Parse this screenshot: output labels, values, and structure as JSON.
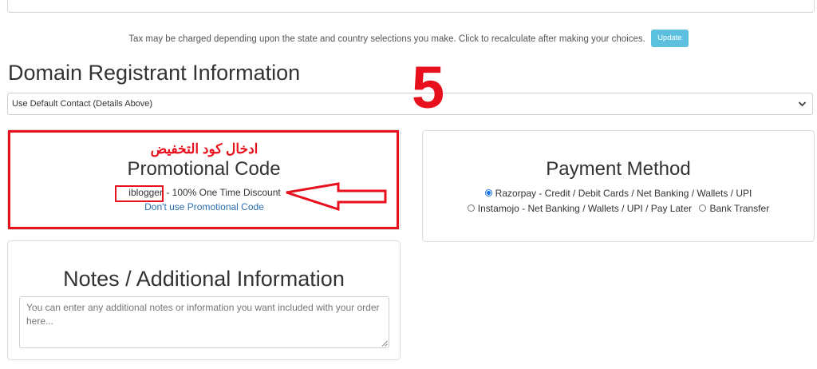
{
  "tax": {
    "text": "Tax may be charged depending upon the state and country selections you make. Click to recalculate after making your choices.",
    "update_label": "Update"
  },
  "registrant": {
    "title": "Domain Registrant Information",
    "select_value": "Use Default Contact (Details Above)"
  },
  "annotation": {
    "step_number": "5",
    "arabic_note": "ادخال كود التخفيض"
  },
  "promo": {
    "title": "Promotional Code",
    "code": "iblogger",
    "discount_text": " - 100% One Time Discount",
    "remove_link": "Don't use Promotional Code"
  },
  "payment": {
    "title": "Payment Method",
    "options": [
      {
        "label": "Razorpay - Credit / Debit Cards / Net Banking / Wallets / UPI",
        "checked": true
      },
      {
        "label": "Instamojo - Net Banking / Wallets / UPI / Pay Later",
        "checked": false
      },
      {
        "label": "Bank Transfer",
        "checked": false
      }
    ]
  },
  "notes": {
    "title": "Notes / Additional Information",
    "placeholder": "You can enter any additional notes or information you want included with your order here..."
  },
  "colors": {
    "annotation_red": "#e8101c",
    "update_button": "#5bc0de",
    "link_blue": "#2a6fb0",
    "radio_blue": "#1a73e8"
  }
}
